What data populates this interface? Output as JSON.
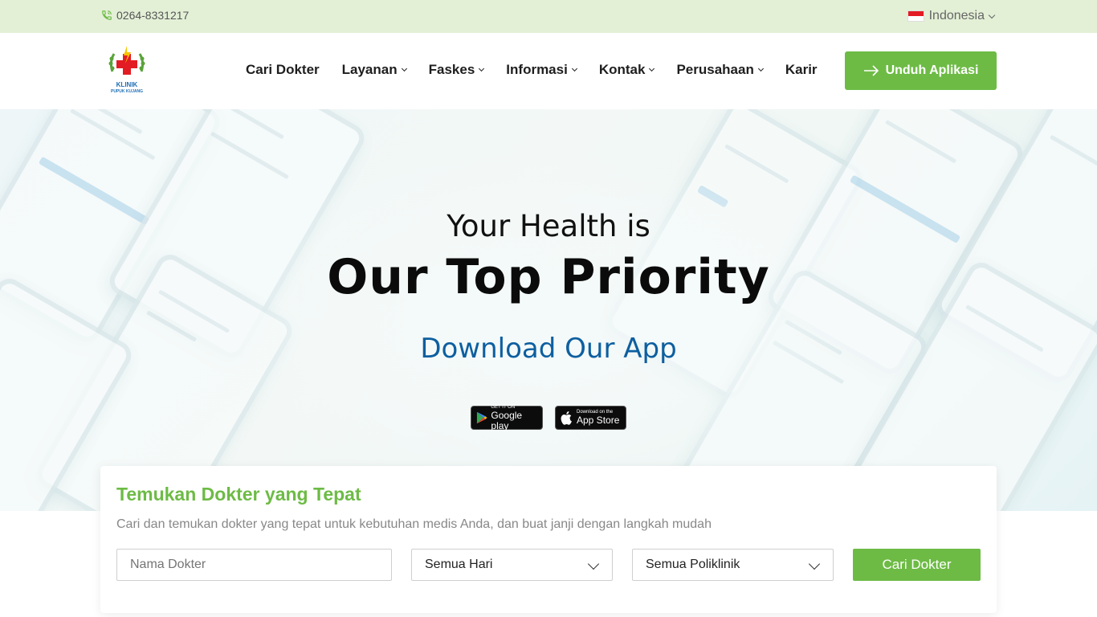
{
  "topbar": {
    "phone": "0264-8331217",
    "phone_icon": "phone-icon",
    "language": "Indonesia",
    "language_flag": "indonesia-flag-icon"
  },
  "header": {
    "logo_line1": "KLINIK",
    "logo_line2": "PUPUK KUJANG",
    "nav": [
      {
        "label": "Cari Dokter",
        "dropdown": false
      },
      {
        "label": "Layanan",
        "dropdown": true
      },
      {
        "label": "Faskes",
        "dropdown": true
      },
      {
        "label": "Informasi",
        "dropdown": true
      },
      {
        "label": "Kontak",
        "dropdown": true
      },
      {
        "label": "Perusahaan",
        "dropdown": true
      },
      {
        "label": "Karir",
        "dropdown": false
      }
    ],
    "app_button": "Unduh Aplikasi"
  },
  "hero": {
    "line1": "Your Health is",
    "line2": "Our Top Priority",
    "line3": "Download Our App",
    "google_play_small": "GET IT ON",
    "google_play_big": "Google play",
    "app_store_small": "Download on the",
    "app_store_big": "App Store"
  },
  "search": {
    "title": "Temukan Dokter yang Tepat",
    "subtitle": "Cari dan temukan dokter yang tepat untuk kebutuhan medis Anda, dan buat janji dengan langkah mudah",
    "name_placeholder": "Nama Dokter",
    "day_selected": "Semua Hari",
    "poli_selected": "Semua Poliklinik",
    "button": "Cari Dokter"
  },
  "colors": {
    "accent_green": "#6dbb45",
    "topbar_bg": "#e3f0d6",
    "hero_blue_text": "#0d5fa0"
  }
}
